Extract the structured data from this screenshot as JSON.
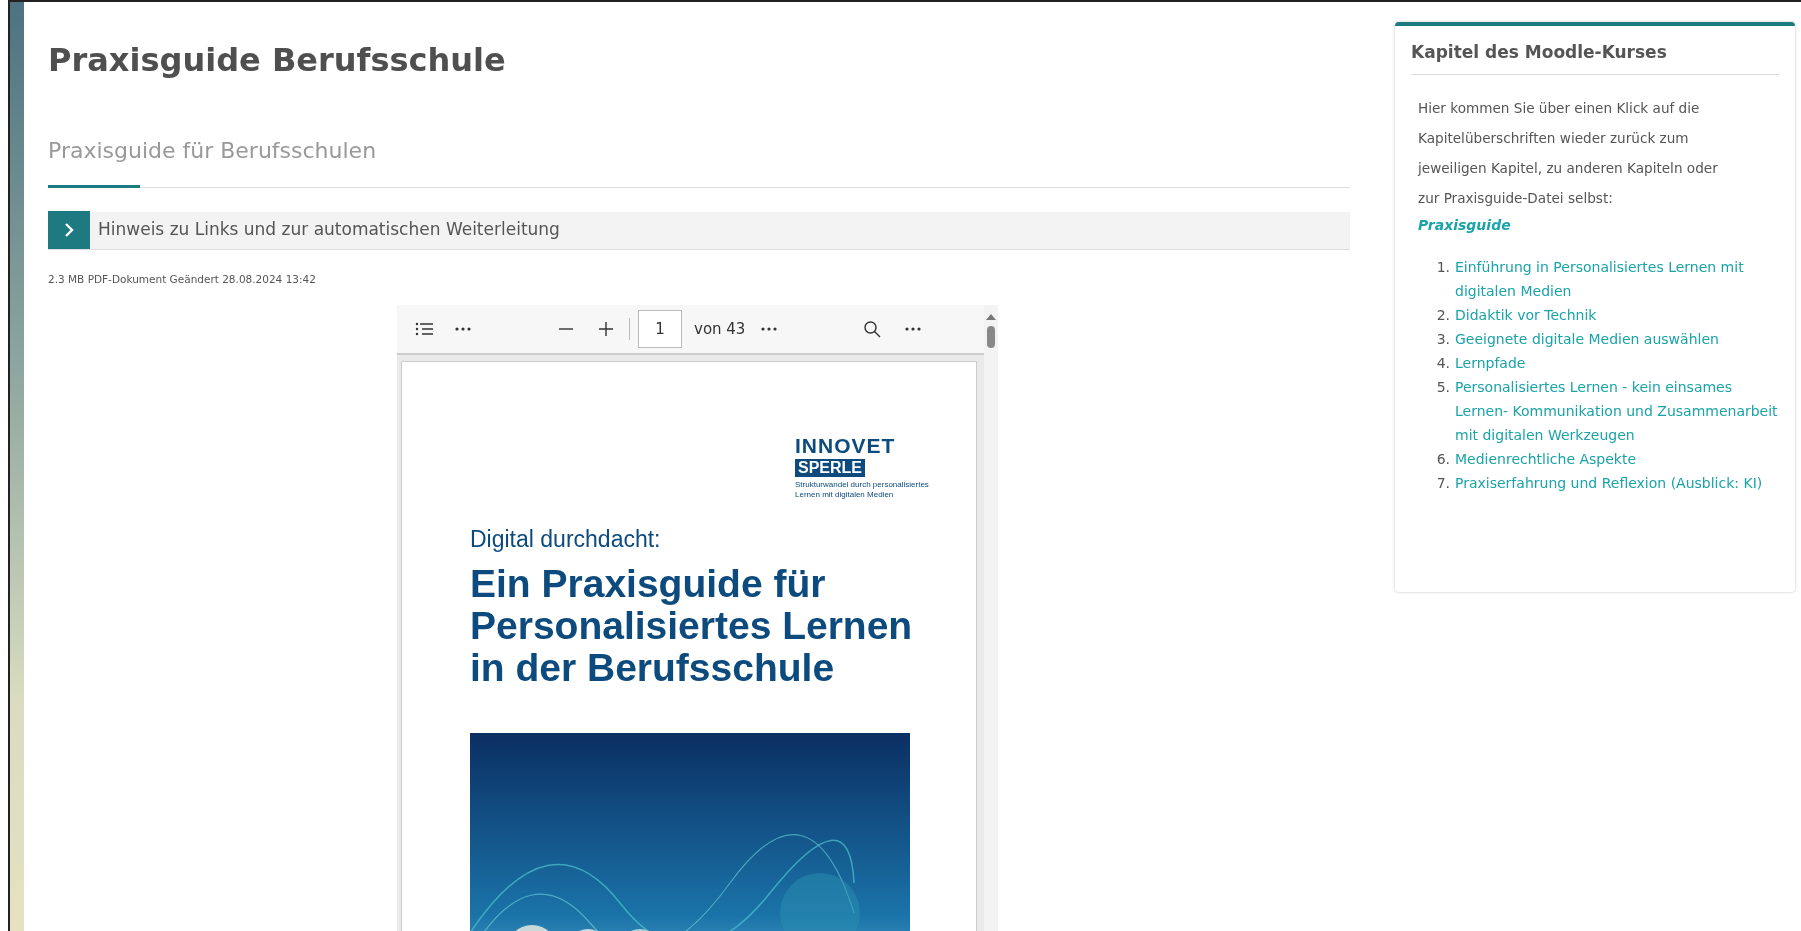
{
  "page": {
    "title": "Praxisguide Berufsschule"
  },
  "tabs": [
    {
      "label": "Praxisguide für Berufsschulen",
      "selected": true
    }
  ],
  "notice": {
    "label": "Hinweis zu Links und zur automatischen Weiterleitung",
    "expanded": false
  },
  "file_info": "2.3 MB PDF-Dokument Geändert 28.08.2024 13:42",
  "pdf_viewer": {
    "page_input": "1",
    "page_count": "von 43",
    "document": {
      "logo_top": "INNOVET",
      "logo_box": "SPERLE",
      "logo_tagline": [
        "Strukturwandel durch personalisiertes",
        "Lernen mit digitalen Medien"
      ],
      "kicker": "Digital durchdacht:",
      "title_lines": [
        "Ein Praxisguide für",
        "Personalisiertes Lernen",
        "in der Berufsschule"
      ],
      "cover": {
        "kind": "picture"
      }
    }
  },
  "sidebar": {
    "title": "Kapitel des Moodle-Kurses",
    "intro": "Hier kommen Sie über einen Klick auf die Kapitelüberschriften wieder zurück zum jeweiligen Kapitel, zu anderen Kapiteln oder zur Praxisguide-Datei selbst:",
    "link": "Praxisguide",
    "chapters": [
      {
        "number": "1.",
        "label": "Einführung in Personalisiertes Lernen mit digitalen Medien"
      },
      {
        "number": "2.",
        "label": "Didaktik vor Technik"
      },
      {
        "number": "3.",
        "label": "Geeignete digitale Medien auswählen"
      },
      {
        "number": "4.",
        "label": "Lernpfade"
      },
      {
        "number": "5.",
        "label": "Personalisiertes Lernen - kein einsames Lernen- Kommunikation und Zusammenarbeit mit digitalen Werkzeugen"
      },
      {
        "number": "6.",
        "label": "Medienrechtliche Aspekte"
      },
      {
        "number": "7.",
        "label": "Praxiserfahrung und Reflexion (Ausblick: KI)"
      }
    ]
  }
}
